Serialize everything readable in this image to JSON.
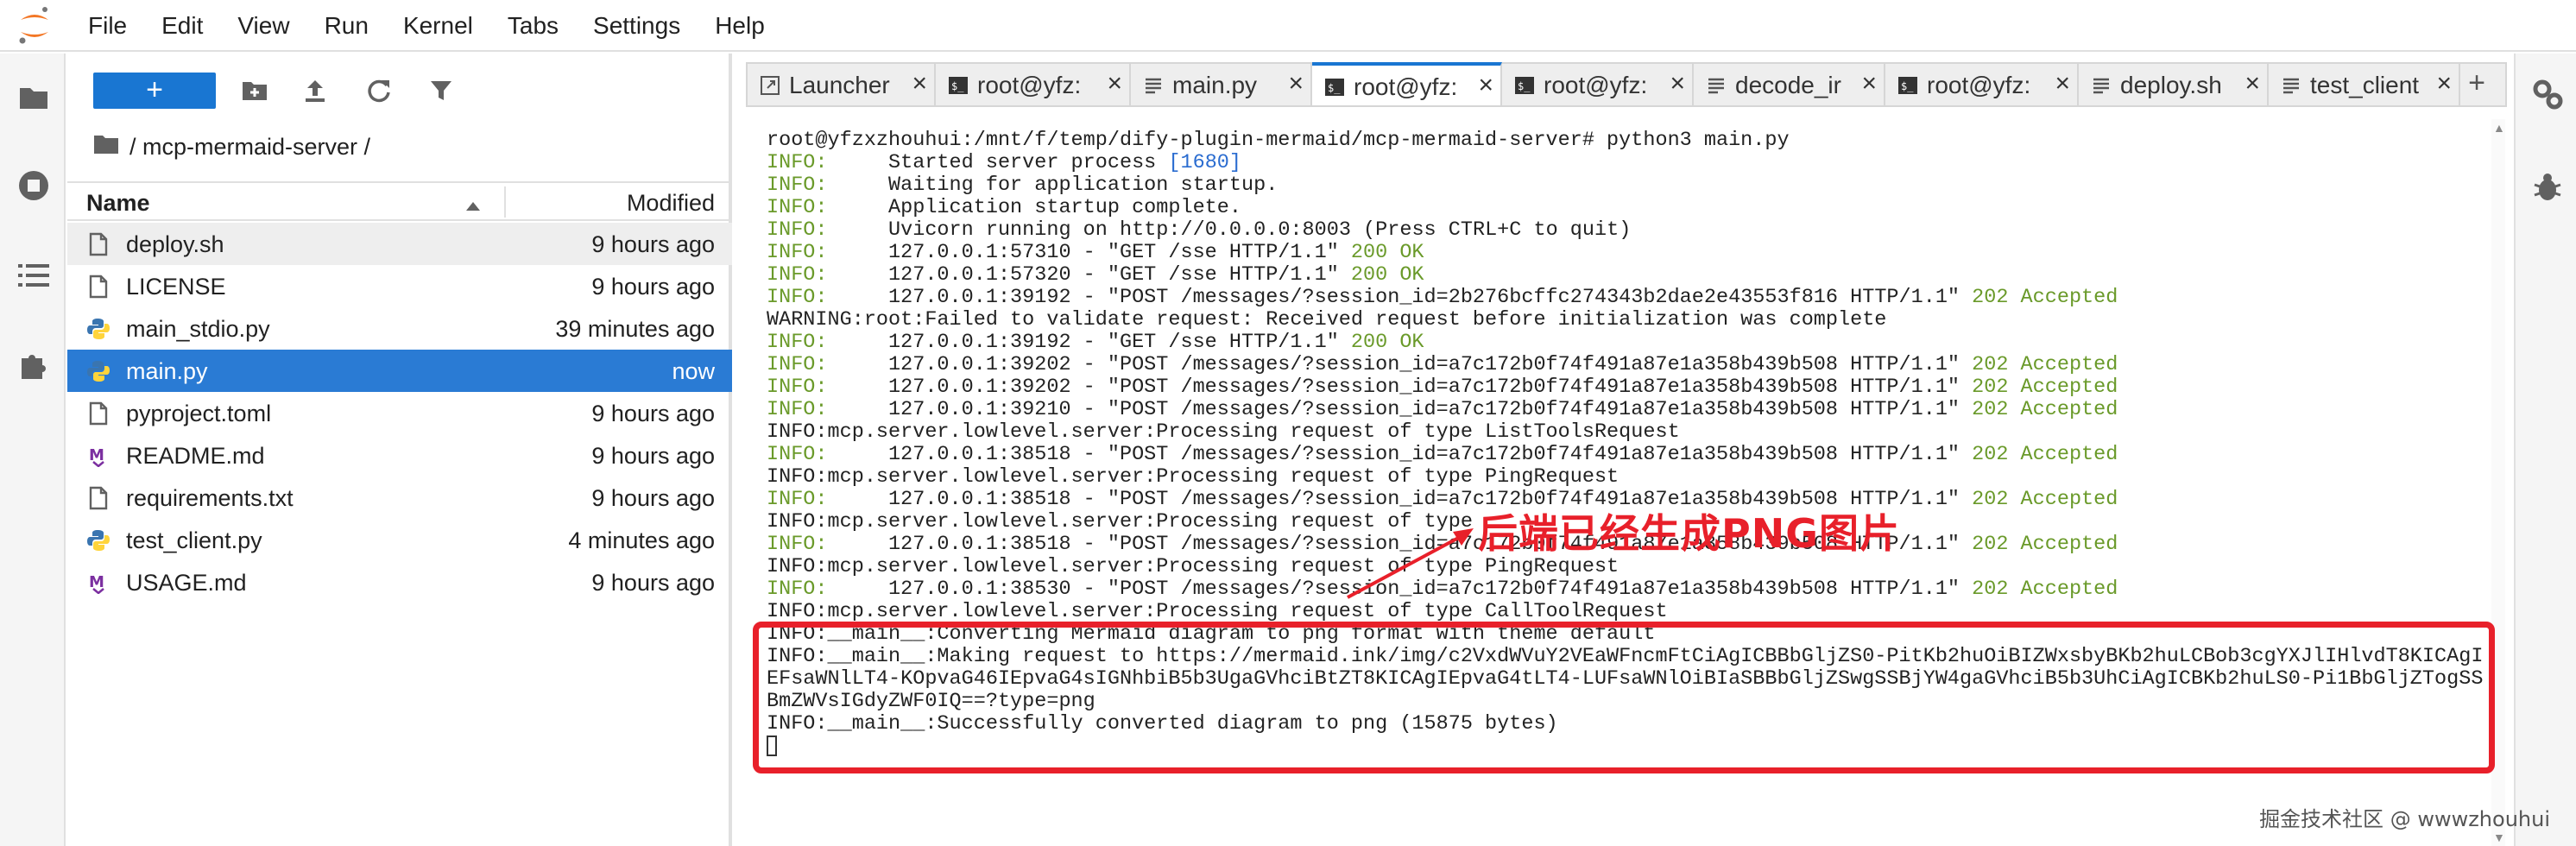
{
  "menubar": {
    "items": [
      "File",
      "Edit",
      "View",
      "Run",
      "Kernel",
      "Tabs",
      "Settings",
      "Help"
    ]
  },
  "file_browser": {
    "new_button": "+",
    "breadcrumb": "/ mcp-mermaid-server /",
    "columns": {
      "name": "Name",
      "modified": "Modified"
    },
    "files": [
      {
        "name": "deploy.sh",
        "modified": "9 hours ago",
        "icon": "file-icon"
      },
      {
        "name": "LICENSE",
        "modified": "9 hours ago",
        "icon": "file-icon"
      },
      {
        "name": "main_stdio.py",
        "modified": "39 minutes ago",
        "icon": "python-icon"
      },
      {
        "name": "main.py",
        "modified": "now",
        "icon": "python-icon"
      },
      {
        "name": "pyproject.toml",
        "modified": "9 hours ago",
        "icon": "file-icon"
      },
      {
        "name": "README.md",
        "modified": "9 hours ago",
        "icon": "markdown-icon"
      },
      {
        "name": "requirements.txt",
        "modified": "9 hours ago",
        "icon": "file-icon"
      },
      {
        "name": "test_client.py",
        "modified": "4 minutes ago",
        "icon": "python-icon"
      },
      {
        "name": "USAGE.md",
        "modified": "9 hours ago",
        "icon": "markdown-icon"
      }
    ]
  },
  "tabs": [
    {
      "label": "Launcher",
      "icon": "launcher-icon"
    },
    {
      "label": "root@yfz:",
      "icon": "terminal-icon"
    },
    {
      "label": "main.py",
      "icon": "text-file-icon"
    },
    {
      "label": "root@yfz:",
      "icon": "terminal-icon"
    },
    {
      "label": "root@yfz:",
      "icon": "terminal-icon"
    },
    {
      "label": "decode_ir",
      "icon": "text-file-icon"
    },
    {
      "label": "root@yfz:",
      "icon": "terminal-icon"
    },
    {
      "label": "deploy.sh",
      "icon": "text-file-icon"
    },
    {
      "label": "test_client",
      "icon": "text-file-icon"
    }
  ],
  "tab_add": "+",
  "terminal": {
    "lines": [
      [
        {
          "t": "root@yfzxzhouhui:/mnt/f/temp/dify-plugin-mermaid/mcp-mermaid-server# python3 main.py",
          "c": "k"
        }
      ],
      [
        {
          "t": "INFO:",
          "c": "g"
        },
        {
          "t": "     Started server process ",
          "c": "k"
        },
        {
          "t": "[1680]",
          "c": "b"
        }
      ],
      [
        {
          "t": "INFO:",
          "c": "g"
        },
        {
          "t": "     Waiting for application startup.",
          "c": "k"
        }
      ],
      [
        {
          "t": "INFO:",
          "c": "g"
        },
        {
          "t": "     Application startup complete.",
          "c": "k"
        }
      ],
      [
        {
          "t": "INFO:",
          "c": "g"
        },
        {
          "t": "     Uvicorn running on ",
          "c": "k"
        },
        {
          "t": "http://0.0.0.0:8003",
          "c": "k"
        },
        {
          "t": " (Press CTRL+C to quit)",
          "c": "k"
        }
      ],
      [
        {
          "t": "INFO:",
          "c": "g"
        },
        {
          "t": "     127.0.0.1:57310 - \"GET /sse HTTP/1.1\" ",
          "c": "k"
        },
        {
          "t": "200 OK",
          "c": "g"
        }
      ],
      [
        {
          "t": "INFO:",
          "c": "g"
        },
        {
          "t": "     127.0.0.1:57320 - \"GET /sse HTTP/1.1\" ",
          "c": "k"
        },
        {
          "t": "200 OK",
          "c": "g"
        }
      ],
      [
        {
          "t": "INFO:",
          "c": "g"
        },
        {
          "t": "     127.0.0.1:39192 - \"POST /messages/?session_id=2b276bcffc274343b2dae2e43553f816 HTTP/1.1\" ",
          "c": "k"
        },
        {
          "t": "202 Accepted",
          "c": "g"
        }
      ],
      [
        {
          "t": "WARNING:root:Failed to validate request: Received request before initialization was complete",
          "c": "k"
        }
      ],
      [
        {
          "t": "INFO:",
          "c": "g"
        },
        {
          "t": "     127.0.0.1:39192 - \"GET /sse HTTP/1.1\" ",
          "c": "k"
        },
        {
          "t": "200 OK",
          "c": "g"
        }
      ],
      [
        {
          "t": "INFO:",
          "c": "g"
        },
        {
          "t": "     127.0.0.1:39202 - \"POST /messages/?session_id=a7c172b0f74f491a87e1a358b439b508 HTTP/1.1\" ",
          "c": "k"
        },
        {
          "t": "202 Accepted",
          "c": "g"
        }
      ],
      [
        {
          "t": "INFO:",
          "c": "g"
        },
        {
          "t": "     127.0.0.1:39202 - \"POST /messages/?session_id=a7c172b0f74f491a87e1a358b439b508 HTTP/1.1\" ",
          "c": "k"
        },
        {
          "t": "202 Accepted",
          "c": "g"
        }
      ],
      [
        {
          "t": "INFO:",
          "c": "g"
        },
        {
          "t": "     127.0.0.1:39210 - \"POST /messages/?session_id=a7c172b0f74f491a87e1a358b439b508 HTTP/1.1\" ",
          "c": "k"
        },
        {
          "t": "202 Accepted",
          "c": "g"
        }
      ],
      [
        {
          "t": "INFO:mcp.server.lowlevel.server:Processing request of type ListToolsRequest",
          "c": "k"
        }
      ],
      [
        {
          "t": "INFO:",
          "c": "g"
        },
        {
          "t": "     127.0.0.1:38518 - \"POST /messages/?session_id=a7c172b0f74f491a87e1a358b439b508 HTTP/1.1\" ",
          "c": "k"
        },
        {
          "t": "202 Accepted",
          "c": "g"
        }
      ],
      [
        {
          "t": "INFO:mcp.server.lowlevel.server:Processing request of type PingRequest",
          "c": "k"
        }
      ],
      [
        {
          "t": "INFO:",
          "c": "g"
        },
        {
          "t": "     127.0.0.1:38518 - \"POST /messages/?session_id=a7c172b0f74f491a87e1a358b439b508 HTTP/1.1\" ",
          "c": "k"
        },
        {
          "t": "202 Accepted",
          "c": "g"
        }
      ],
      [
        {
          "t": "INFO:mcp.server.lowlevel.server:Processing request of type",
          "c": "k"
        }
      ],
      [
        {
          "t": "INFO:",
          "c": "g"
        },
        {
          "t": "     127.0.0.1:38518 - \"POST /messages/?session_id=a7c172b0f74f491a87e1a358b439b508 HTTP/1.1\" ",
          "c": "k"
        },
        {
          "t": "202 Accepted",
          "c": "g"
        }
      ],
      [
        {
          "t": "INFO:mcp.server.lowlevel.server:Processing request of type PingRequest",
          "c": "k"
        }
      ],
      [
        {
          "t": "INFO:",
          "c": "g"
        },
        {
          "t": "     127.0.0.1:38530 - \"POST /messages/?session_id=a7c172b0f74f491a87e1a358b439b508 HTTP/1.1\" ",
          "c": "k"
        },
        {
          "t": "202 Accepted",
          "c": "g"
        }
      ],
      [
        {
          "t": "INFO:mcp.server.lowlevel.server:Processing request of type CallToolRequest",
          "c": "k"
        }
      ],
      [
        {
          "t": "INFO:__main__:Converting Mermaid diagram to png format with theme default",
          "c": "k"
        }
      ],
      [
        {
          "t": "INFO:__main__:Making request to https://mermaid.ink/img/c2VxdWVuY2VEaWFncmFtCiAgICBBbGljZS0-PitKb2huOiBIZWxsbyBKb2huLCBob3cgYXJlIHlvdT8KICAgI",
          "c": "k"
        }
      ],
      [
        {
          "t": "EFsaWNlLT4-KOpvaG46IEpvaG4sIGNhbiB5b3UgaGVhciBtZT8KICAgIEpvaG4tLT4-LUFsaWNlOiBIaSBBbGljZSwgSSBjYW4gaGVhciB5b3UhCiAgICBKb2huLS0-Pi1BbGljZTogSS",
          "c": "k"
        }
      ],
      [
        {
          "t": "BmZWVsIGdyZWF0IQ==?type=png",
          "c": "k"
        }
      ],
      [
        {
          "t": "INFO:__main__:Successfully converted diagram to png (15875 bytes)",
          "c": "k"
        }
      ]
    ]
  },
  "annotation": {
    "text": "后端已经生成PNG图片"
  },
  "watermark": "掘金技术社区 @ wwwzhouhui",
  "colors": {
    "accent": "#1976d2",
    "selected": "#2a7bd4",
    "annotation": "#e8202a",
    "ok_green": "#6a9a2a"
  }
}
